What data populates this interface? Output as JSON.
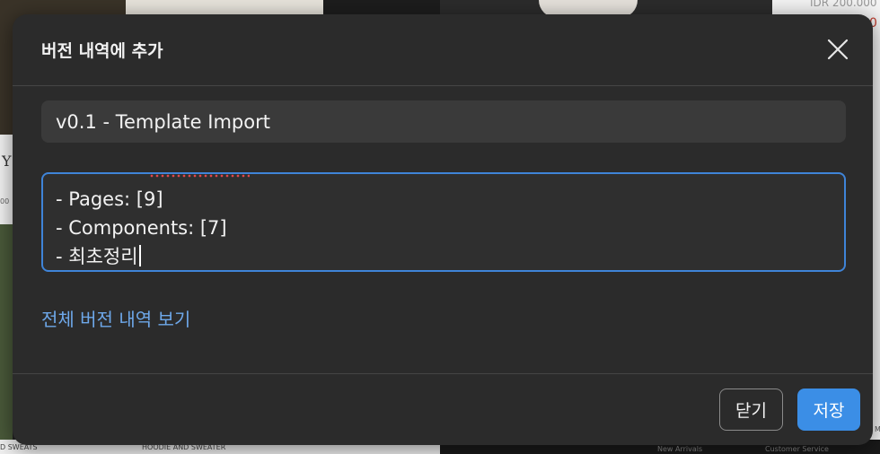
{
  "background": {
    "price_top": "IDR 200.000",
    "sale_mark": "0",
    "side_letter": "Y",
    "side_digits": "00",
    "caption_left": "D SWEATS",
    "caption_mid": "HOODIE AND SWEATER",
    "caption_new": "New Arrivals",
    "caption_service": "Customer Service",
    "edge_letter": "M"
  },
  "modal": {
    "title": "버전 내역에 추가",
    "close_icon": "close-icon",
    "version_title": "v0.1 - Template Import",
    "description_lines": [
      "- Pages: [9]",
      "- Components: [7]",
      "- 최초정리"
    ],
    "history_link": "전체 버전 내역 보기",
    "close_button": "닫기",
    "save_button": "저장"
  },
  "colors": {
    "modal_bg": "#2b2b2b",
    "accent": "#3b8ee6",
    "link": "#6ea8ea",
    "focus_border": "#3f84d8"
  }
}
